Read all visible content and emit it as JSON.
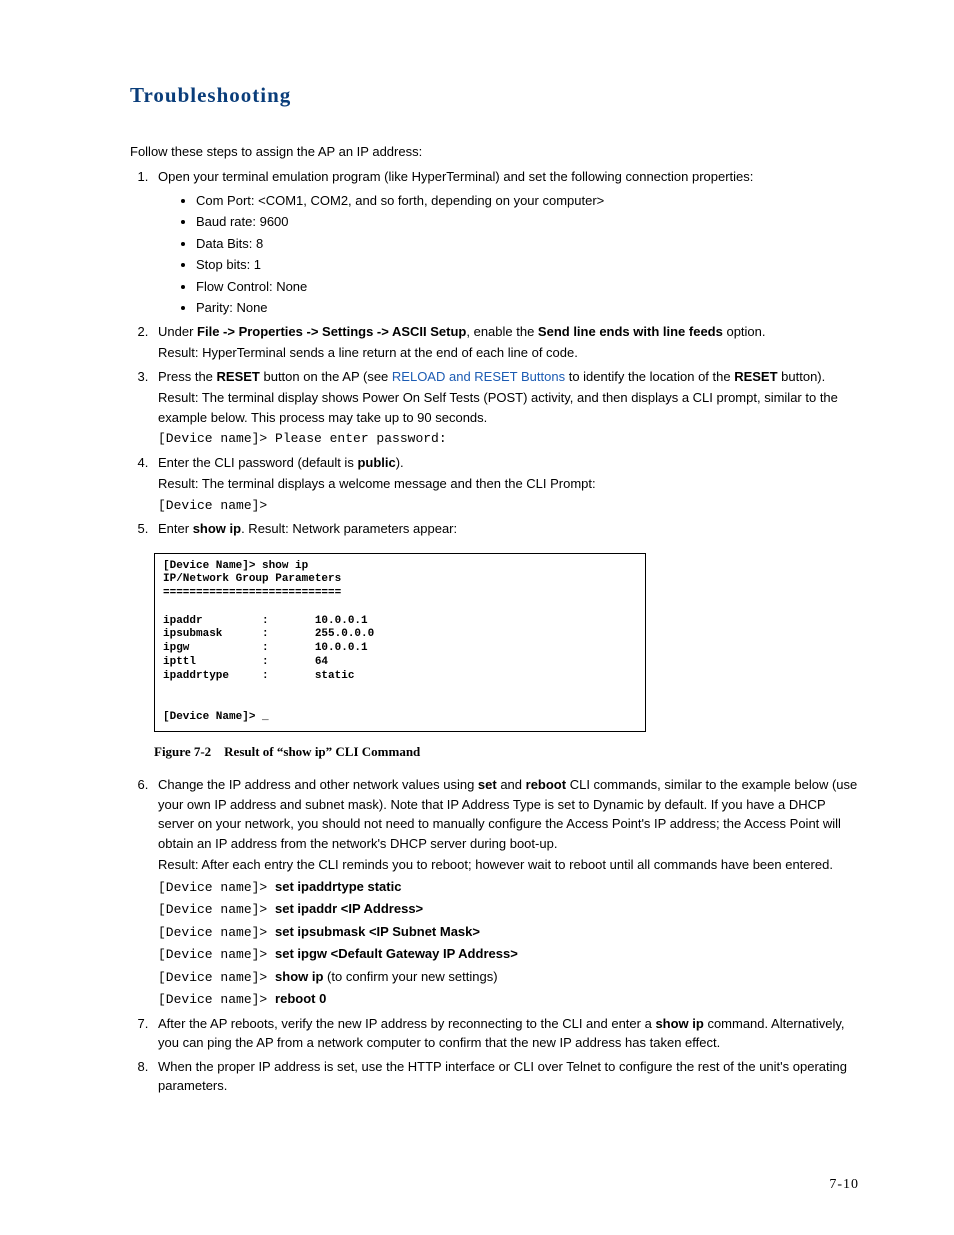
{
  "heading": "Troubleshooting",
  "intro": "Follow these steps to assign the AP an IP address:",
  "step1": {
    "text": "Open your terminal emulation program (like HyperTerminal) and set the following connection properties:",
    "bullets": [
      "Com Port: <COM1, COM2, and so forth, depending on your computer>",
      "Baud rate: 9600",
      "Data Bits: 8",
      "Stop bits: 1",
      "Flow Control: None",
      "Parity: None"
    ]
  },
  "step2": {
    "prefix": "Under ",
    "bold1": "File -> Properties -> Settings -> ASCII Setup",
    "mid": ", enable the ",
    "bold2": "Send line ends with line feeds",
    "suffix": " option.",
    "result": "Result: HyperTerminal sends a line return at the end of each line of code."
  },
  "step3": {
    "p1": "Press the ",
    "b1": "RESET",
    "p2": " button on the AP (see ",
    "link": "RELOAD and RESET Buttons",
    "p3": " to identify the location of the ",
    "b2": "RESET",
    "p4": " button).",
    "result": "Result: The terminal display shows Power On Self Tests (POST) activity, and then displays a CLI prompt, similar to the example below. This process may take up to 90 seconds.",
    "cli": "[Device name]> Please enter password:"
  },
  "step4": {
    "p1": "Enter the CLI password (default is ",
    "b1": "public",
    "p2": ").",
    "result": "Result: The terminal displays a welcome message and then the CLI Prompt:",
    "cli": "[Device name]>"
  },
  "step5": {
    "p1": "Enter ",
    "b1": "show ip",
    "p2": ". Result: Network parameters appear:"
  },
  "figure": {
    "content": "[Device Name]> show ip\nIP/Network Group Parameters\n===========================\n\nipaddr         :       10.0.0.1\nipsubmask      :       255.0.0.0\nipgw           :       10.0.0.1\nipttl          :       64\nipaddrtype     :       static\n\n\n[Device Name]> _",
    "caption_label": "Figure 7-2",
    "caption_title": "Result of “show ip” CLI Command"
  },
  "step6": {
    "p1": "Change the IP address and other network values using ",
    "b1": "set",
    "p2": " and ",
    "b2": "reboot",
    "p3": " CLI commands, similar to the example below (use your own IP address and subnet mask). Note that IP Address Type is set to Dynamic by default. If you have a DHCP server on your network, you should not need to manually configure the Access Point's IP address; the Access Point will obtain an IP address from the network's DHCP server during boot-up.",
    "result": "Result: After each entry the CLI reminds you to reboot; however wait to reboot until all commands have been entered.",
    "cli": [
      {
        "prompt": "[Device name]> ",
        "cmd": "set ipaddrtype static",
        "note": ""
      },
      {
        "prompt": "[Device name]> ",
        "cmd": "set ipaddr <IP Address>",
        "note": ""
      },
      {
        "prompt": "[Device name]> ",
        "cmd": "set ipsubmask <IP Subnet Mask>",
        "note": ""
      },
      {
        "prompt": "[Device name]> ",
        "cmd": "set ipgw <Default Gateway IP Address>",
        "note": ""
      },
      {
        "prompt": "[Device name]> ",
        "cmd": "show ip",
        "note": "  (to confirm your new settings)"
      },
      {
        "prompt": "[Device name]> ",
        "cmd": "reboot 0",
        "note": ""
      }
    ]
  },
  "step7": {
    "p1": "After the AP reboots, verify the new IP address by reconnecting to the CLI and enter a ",
    "b1": "show ip",
    "p2": " command. Alternatively, you can ping the AP from a network computer to confirm that the new IP address has taken effect."
  },
  "step8": "When the proper IP address is set, use the HTTP interface or CLI over Telnet to configure the rest of the unit's operating parameters.",
  "page_number": "7-10"
}
